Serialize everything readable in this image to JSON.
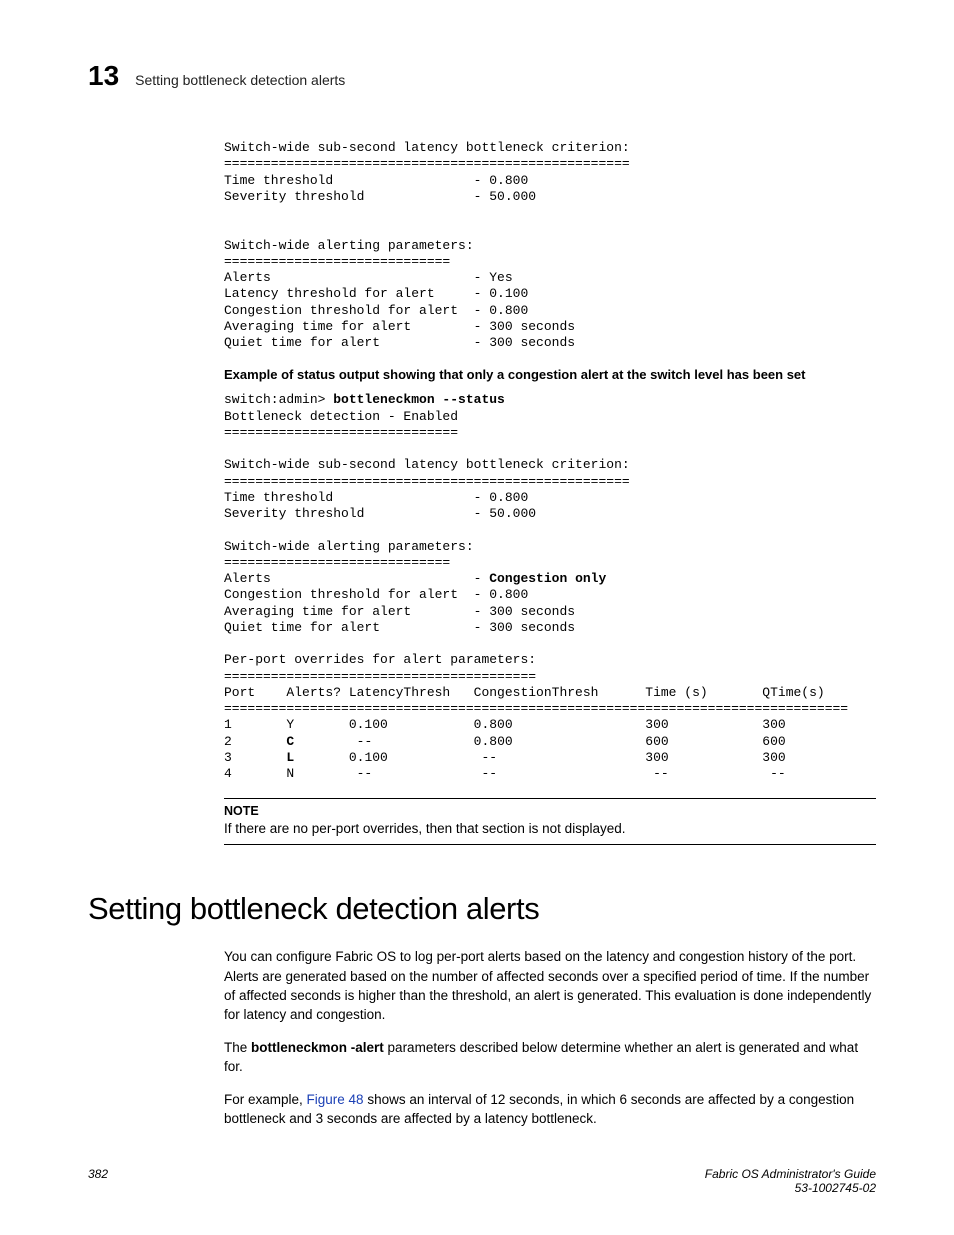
{
  "header": {
    "chapter_number": "13",
    "running_title": "Setting bottleneck detection alerts"
  },
  "pre1": {
    "l1": "Switch-wide sub-second latency bottleneck criterion:",
    "l2": "====================================================",
    "l3": "Time threshold                  - 0.800",
    "l4": "Severity threshold              - 50.000",
    "l5": "",
    "l6": "",
    "l7": "Switch-wide alerting parameters:",
    "l8": "=============================",
    "l9": "Alerts                          - Yes",
    "l10": "Latency threshold for alert     - 0.100",
    "l11": "Congestion threshold for alert  - 0.800",
    "l12": "Averaging time for alert        - 300 seconds",
    "l13": "Quiet time for alert            - 300 seconds"
  },
  "example_label": "Example of status output showing that only a congestion alert at the switch level has been set",
  "pre2": {
    "prompt": "switch:admin> ",
    "cmd": "bottleneckmon --status",
    "l2": "Bottleneck detection - Enabled",
    "l3": "==============================",
    "l4": "",
    "l5": "Switch-wide sub-second latency bottleneck criterion:",
    "l6": "====================================================",
    "l7": "Time threshold                  - 0.800",
    "l8": "Severity threshold              - 50.000",
    "l9": "",
    "l10": "Switch-wide alerting parameters:",
    "l11": "=============================",
    "l12a": "Alerts                          - ",
    "l12b": "Congestion only",
    "l13": "Congestion threshold for alert  - 0.800",
    "l14": "Averaging time for alert        - 300 seconds",
    "l15": "Quiet time for alert            - 300 seconds",
    "l16": "",
    "l17": "Per-port overrides for alert parameters:",
    "l18": "========================================",
    "l19": "Port    Alerts? LatencyThresh   CongestionThresh      Time (s)       QTime(s)",
    "l20": "================================================================================",
    "r1a": "1       Y       0.100           0.800                 300            300",
    "r2a": "2       ",
    "r2b": "C",
    "r2c": "        --             0.800                 600            600",
    "r3a": "3       ",
    "r3b": "L",
    "r3c": "       0.100            --                   300            300",
    "r4a": "4       N        --              --                    --             --"
  },
  "note": {
    "label": "NOTE",
    "text": "If there are no per-port overrides, then that section is not displayed."
  },
  "section_title": "Setting bottleneck detection alerts",
  "para1": "You can configure Fabric OS to log per-port alerts based on the latency and congestion history of the port. Alerts are generated based on the number of affected seconds over a specified period of time. If the number of affected seconds is higher than the threshold, an alert is generated. This evaluation is done independently for latency and congestion.",
  "para2_a": "The ",
  "para2_cmd": "bottleneckmon -alert",
  "para2_b": " parameters described below determine whether an alert is generated and what for.",
  "para3_a": "For example, ",
  "para3_fig": "Figure 48",
  "para3_b": " shows an interval of 12 seconds, in which 6 seconds are affected by a congestion bottleneck and 3 seconds are affected by a latency bottleneck.",
  "footer": {
    "page_num": "382",
    "guide_title": "Fabric OS Administrator's Guide",
    "doc_id": "53-1002745-02"
  },
  "chart_data": {
    "type": "table",
    "title": "Per-port overrides for alert parameters",
    "columns": [
      "Port",
      "Alerts?",
      "LatencyThresh",
      "CongestionThresh",
      "Time (s)",
      "QTime(s)"
    ],
    "rows": [
      [
        "1",
        "Y",
        "0.100",
        "0.800",
        "300",
        "300"
      ],
      [
        "2",
        "C",
        "--",
        "0.800",
        "600",
        "600"
      ],
      [
        "3",
        "L",
        "0.100",
        "--",
        "300",
        "300"
      ],
      [
        "4",
        "N",
        "--",
        "--",
        "--",
        "--"
      ]
    ]
  }
}
